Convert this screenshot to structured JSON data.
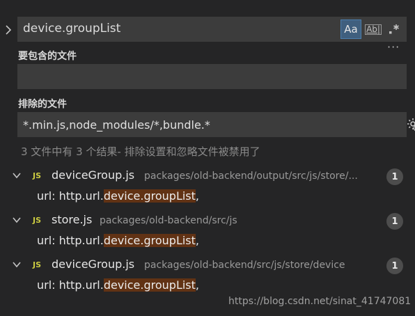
{
  "search": {
    "query": "device.groupList",
    "match_case_label": "Aa",
    "whole_word_label": "Ab|",
    "regex_label": ".*",
    "more_label": "···"
  },
  "include": {
    "label": "要包含的文件",
    "value": ""
  },
  "exclude": {
    "label": "排除的文件",
    "value": "*.min.js,node_modules/*,bundle.*"
  },
  "summary": "3 文件中有 3 个结果- 排除设置和忽略文件被禁用了",
  "results": [
    {
      "icon": "JS",
      "filename": "deviceGroup.js",
      "path": "packages/old-backend/output/src/js/store/...",
      "count": "1",
      "match": {
        "before": "url: http.url.",
        "highlight": "device.groupList",
        "after": ","
      }
    },
    {
      "icon": "JS",
      "filename": "store.js",
      "path": "packages/old-backend/src/js",
      "count": "1",
      "match": {
        "before": "url: http.url.",
        "highlight": "device.groupList",
        "after": ","
      }
    },
    {
      "icon": "JS",
      "filename": "deviceGroup.js",
      "path": "packages/old-backend/src/js/store/device",
      "count": "1",
      "match": {
        "before": "url: http.url.",
        "highlight": "device.groupList",
        "after": ","
      }
    }
  ],
  "watermark": "https://blog.csdn.net/sinat_41747081",
  "colors": {
    "background": "#252526",
    "input_background": "#3c3c3c",
    "highlight": "#613214",
    "js_icon": "#cbcb41",
    "active_option": "#3f5f7e"
  }
}
